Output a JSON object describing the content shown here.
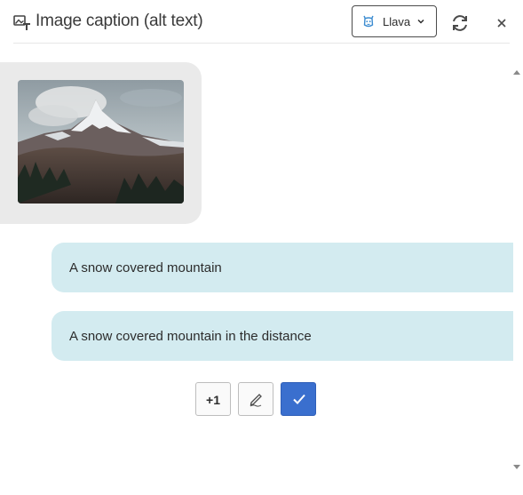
{
  "header": {
    "title": "Image caption (alt text)",
    "title_icon": "image-text-icon",
    "model_selector": {
      "selected": "Llava",
      "icon": "llava-model-icon"
    },
    "refresh_icon": "refresh-icon",
    "close_icon": "close-icon"
  },
  "conversation": {
    "image": {
      "description_icon": "mountain-thumbnail"
    },
    "captions": [
      {
        "text": "A snow covered mountain"
      },
      {
        "text": "A snow covered mountain in the distance"
      }
    ]
  },
  "actions": {
    "plus_one_label": "+1",
    "edit_icon": "edit-pen-icon",
    "accept_icon": "checkmark-icon"
  },
  "colors": {
    "accent": "#3a6fce",
    "caption_bubble": "#d3ebf0",
    "image_bubble": "#eaeaea"
  }
}
